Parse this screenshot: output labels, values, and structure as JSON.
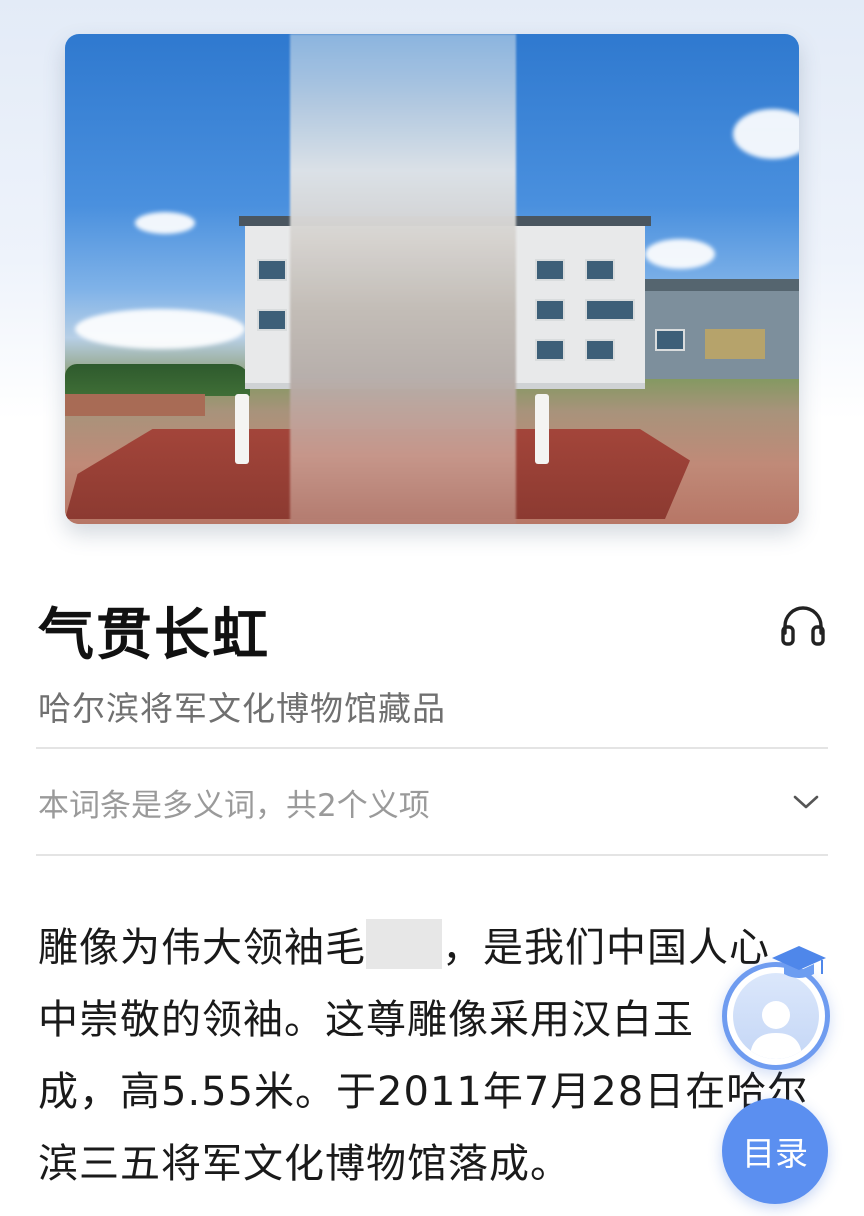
{
  "entry": {
    "title": "气贯长虹",
    "subtitle": "哈尔滨将军文化博物馆藏品",
    "polysemy_notice": "本词条是多义词，共2个义项"
  },
  "body": {
    "line1_a": "雕像为伟大领袖毛",
    "line1_b": "，是我们中国人心",
    "line2": "中崇敬的领袖。这尊雕像采用汉白玉",
    "line3": "成，高5.55米。于2011年7月28日在哈尔",
    "line4": "滨三五将军文化博物馆落成。"
  },
  "buttons": {
    "toc_label": "目录"
  },
  "icons": {
    "audio": "headphones-icon",
    "expand": "chevron-down-icon",
    "assistant": "avatar-icon",
    "cap": "graduation-cap-icon"
  },
  "colors": {
    "accent": "#5b8ff0",
    "title": "#111111",
    "muted": "#9a9a9a"
  }
}
